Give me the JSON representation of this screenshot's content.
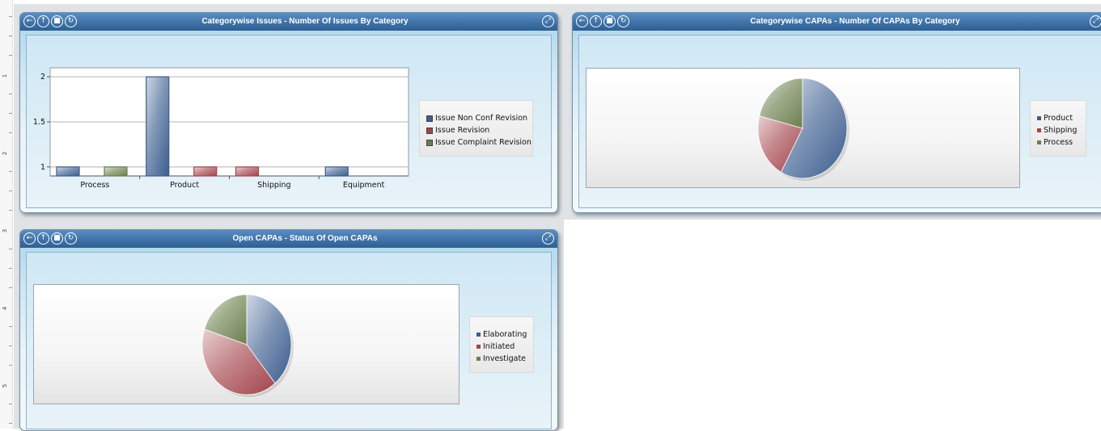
{
  "ruler": {
    "marks": [
      "1",
      "2",
      "3",
      "4",
      "5"
    ]
  },
  "toolbar_glyphs": [
    "←",
    "↑",
    "■",
    "↻"
  ],
  "expand_glyph": "⤢",
  "colors": {
    "blue": "#3c5d8f",
    "red": "#a3444b",
    "green": "#6b7f4c",
    "titlebar": "#3f72a8"
  },
  "panels": [
    {
      "title": "Categorywise Issues - Number Of Issues By Category",
      "chart_data": {
        "type": "bar",
        "categories": [
          "Process",
          "Product",
          "Shipping",
          "Equipment"
        ],
        "series": [
          {
            "name": "Issue Non Conf Revision",
            "color": "#3c5d8f",
            "values": [
              1,
              2,
              null,
              1
            ]
          },
          {
            "name": "Issue Revision",
            "color": "#a3444b",
            "values": [
              null,
              1,
              1,
              null
            ]
          },
          {
            "name": "Issue Complaint Revision",
            "color": "#6b7f4c",
            "values": [
              1,
              null,
              null,
              null
            ]
          }
        ],
        "ylim": [
          0.9,
          2.1
        ],
        "yticks": [
          "1",
          "1.5",
          "2"
        ],
        "ytick_values": [
          1,
          1.5,
          2
        ],
        "grid": true,
        "legend_position": "right"
      }
    },
    {
      "title": "Categorywise CAPAs - Number Of CAPAs By Category",
      "chart_data": {
        "type": "pie",
        "labels": [
          "Product",
          "Shipping",
          "Process"
        ],
        "values": [
          58,
          21,
          21
        ],
        "colors": [
          "#3c5d8f",
          "#a3444b",
          "#6b7f4c"
        ],
        "legend_position": "right"
      }
    },
    {
      "title": "Open CAPAs - Status Of Open CAPAs",
      "chart_data": {
        "type": "pie",
        "labels": [
          "Elaborating",
          "Initiated",
          "Investigate"
        ],
        "values": [
          39,
          41,
          20
        ],
        "colors": [
          "#3c5d8f",
          "#a3444b",
          "#6b7f4c"
        ],
        "legend_position": "right"
      }
    }
  ]
}
